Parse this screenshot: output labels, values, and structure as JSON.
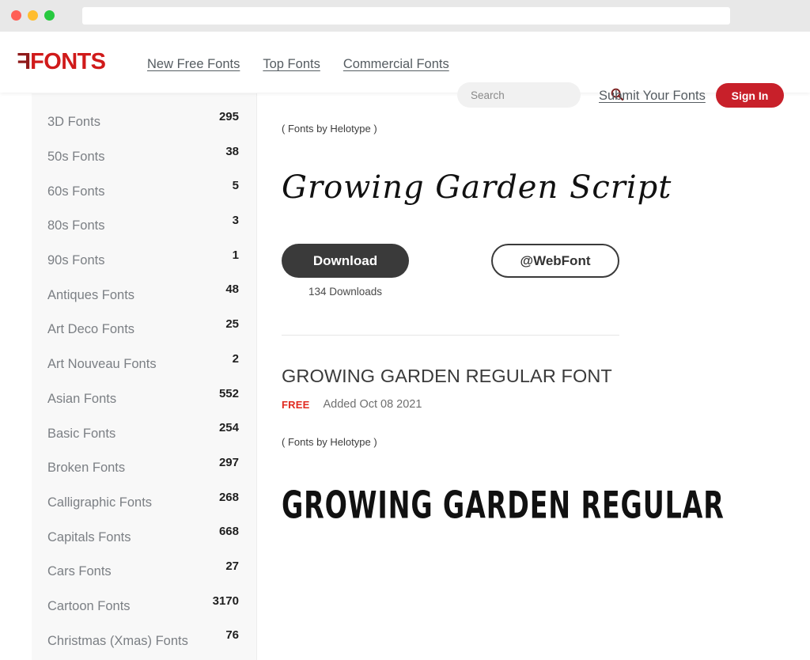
{
  "browser": {
    "url_value": "",
    "url_placeholder": "",
    "traffic_lights": [
      "close",
      "minimize",
      "maximize"
    ]
  },
  "header": {
    "logo": {
      "mark": "F",
      "text": "FONTS"
    },
    "nav": [
      {
        "label": "New Free Fonts"
      },
      {
        "label": "Top Fonts"
      },
      {
        "label": "Commercial Fonts"
      }
    ],
    "search": {
      "value": "",
      "placeholder": "Search",
      "icon": "search-icon"
    },
    "submit_link": "Submit Your Fonts",
    "sign_in": "Sign In",
    "accent_color": "#c8202a",
    "logo_mark_color": "#8f1a1a",
    "logo_text_color": "#d01a1a"
  },
  "sidebar": {
    "items": [
      {
        "label": "3D Fonts",
        "count": "295"
      },
      {
        "label": "50s Fonts",
        "count": "38"
      },
      {
        "label": "60s Fonts",
        "count": "5"
      },
      {
        "label": "80s Fonts",
        "count": "3"
      },
      {
        "label": "90s Fonts",
        "count": "1"
      },
      {
        "label": "Antiques Fonts",
        "count": "48"
      },
      {
        "label": "Art Deco Fonts",
        "count": "25"
      },
      {
        "label": "Art Nouveau Fonts",
        "count": "2"
      },
      {
        "label": "Asian Fonts",
        "count": "552"
      },
      {
        "label": "Basic Fonts",
        "count": "254"
      },
      {
        "label": "Broken Fonts",
        "count": "297"
      },
      {
        "label": "Calligraphic Fonts",
        "count": "268"
      },
      {
        "label": "Capitals Fonts",
        "count": "668"
      },
      {
        "label": "Cars Fonts",
        "count": "27"
      },
      {
        "label": "Cartoon Fonts",
        "count": "3170"
      },
      {
        "label": "Christmas (Xmas) Fonts",
        "count": "76"
      }
    ]
  },
  "main": {
    "font_script": {
      "foundry": "( Fonts by Helotype )",
      "preview_text": "Growing Garden Script",
      "download_label": "Download",
      "download_count": "134 Downloads",
      "webfont_label": "@WebFont"
    },
    "font_regular": {
      "title": "GROWING GARDEN REGULAR FONT",
      "price_badge": "FREE",
      "added": "Added Oct 08 2021",
      "badge_color": "#e02a20",
      "foundry": "( Fonts by Helotype )",
      "preview_text": "GROWING GARDEN REGULAR"
    }
  }
}
